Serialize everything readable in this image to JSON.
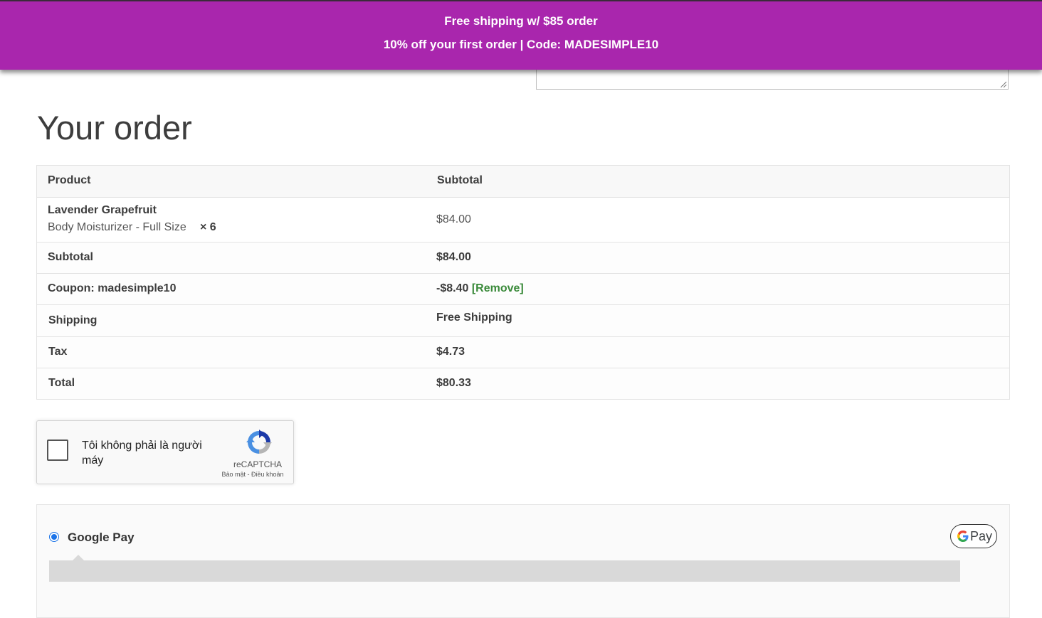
{
  "banner": {
    "line1": "Free shipping w/ $85 order",
    "line2": "10% off your first order | Code: MADESIMPLE10",
    "color": "#a926ad"
  },
  "page_title": "Your order",
  "order": {
    "header": {
      "product": "Product",
      "subtotal": "Subtotal"
    },
    "item": {
      "name": "Lavender Grapefruit",
      "variant": "Body Moisturizer - Full Size",
      "qty": "× 6",
      "total": "$84.00"
    },
    "subtotal": {
      "label": "Subtotal",
      "value": "$84.00"
    },
    "coupon": {
      "label": "Coupon: madesimple10",
      "value": "-$8.40",
      "remove": "[Remove]"
    },
    "shipping": {
      "label": "Shipping",
      "value": "Free Shipping"
    },
    "tax": {
      "label": "Tax",
      "value": "$4.73"
    },
    "total": {
      "label": "Total",
      "value": "$80.33"
    }
  },
  "captcha": {
    "label": "Tôi không phải là người máy",
    "brand": "reCAPTCHA",
    "terms": "Bảo mật - Điều khoản"
  },
  "payment": {
    "method_label": "Google Pay",
    "button_text": "Pay",
    "accent": "#1a73e8"
  }
}
